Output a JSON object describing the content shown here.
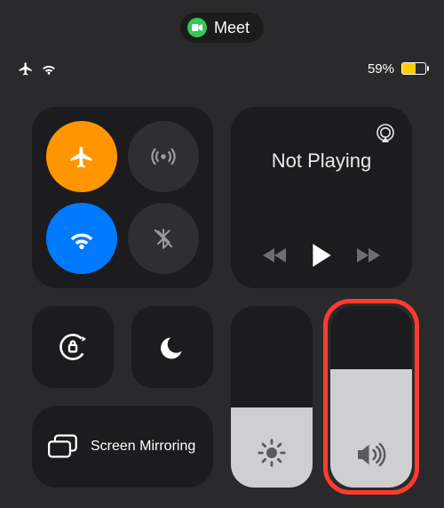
{
  "pill": {
    "app_name": "Meet"
  },
  "statusbar": {
    "battery_percent_label": "59%",
    "battery_level": 59
  },
  "connectivity": {
    "airplane_on": true,
    "cellular_on": false,
    "wifi_on": true,
    "bluetooth_on": false
  },
  "media": {
    "title": "Not Playing"
  },
  "screen_mirroring": {
    "label": "Screen Mirroring"
  },
  "sliders": {
    "brightness_percent": 44,
    "volume_percent": 65
  },
  "highlight": {
    "target": "volume-slider"
  }
}
